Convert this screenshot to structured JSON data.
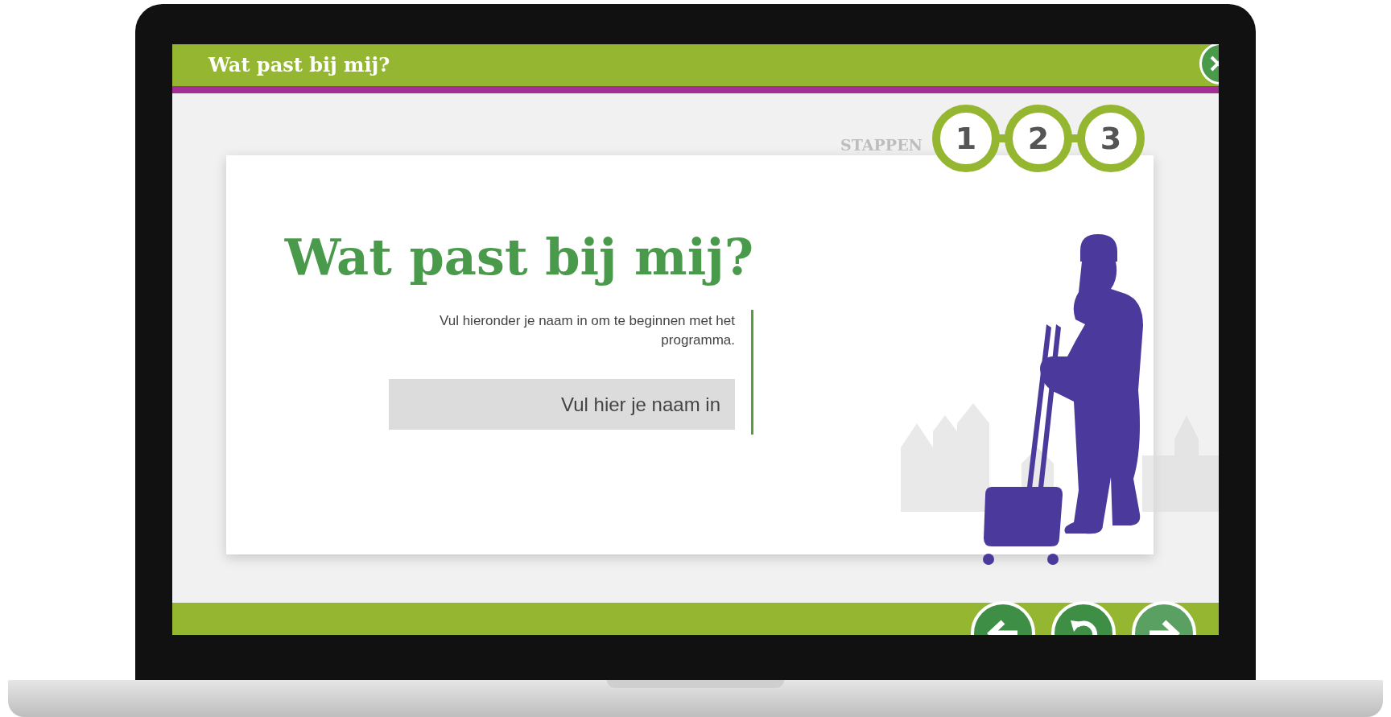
{
  "window": {
    "title": "Wat past bij mij?"
  },
  "steps": {
    "label": "STAPPEN",
    "items": [
      {
        "number": "1"
      },
      {
        "number": "2"
      },
      {
        "number": "3"
      }
    ]
  },
  "intro": {
    "heading": "Wat past bij mij?",
    "text": "Vul hieronder je naam in om te beginnen met het programma.",
    "name_field": {
      "placeholder": "Vul hier je naam in"
    }
  }
}
